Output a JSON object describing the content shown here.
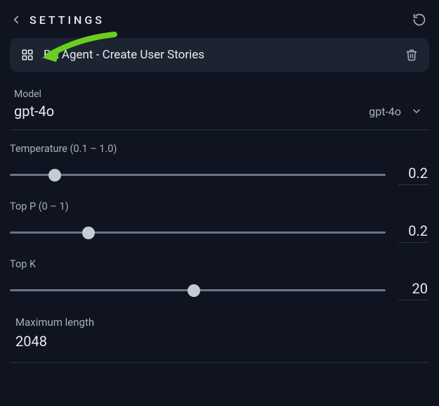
{
  "header": {
    "title": "SETTINGS"
  },
  "agent": {
    "name": "BA Agent - Create User Stories"
  },
  "model": {
    "label": "Model",
    "value": "gpt-4o",
    "selected": "gpt-4o"
  },
  "params": {
    "temperature": {
      "label": "Temperature (0.1 – 1.0)",
      "value": "0.2",
      "min": 0.1,
      "max": 1.0,
      "percent": 12
    },
    "top_p": {
      "label": "Top P (0 – 1)",
      "value": "0.2",
      "min": 0,
      "max": 1.0,
      "percent": 21
    },
    "top_k": {
      "label": "Top K",
      "value": "20",
      "percent": 49
    }
  },
  "max_length": {
    "label": "Maximum length",
    "value": "2048"
  },
  "colors": {
    "arrow": "#6bce1f"
  }
}
